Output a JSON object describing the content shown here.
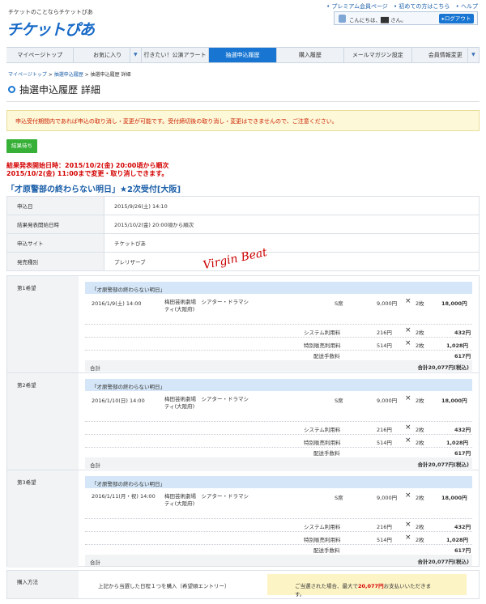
{
  "header": {
    "tagline": "チケットのことならチケットぴあ",
    "logo": "チケットぴあ",
    "links": [
      "• プレミアム会員ページ",
      "• 初めての方はこちら",
      "• ヘルプ"
    ],
    "greeting": "こんにちは、██ さん。",
    "logout": "▸ログアウト"
  },
  "nav": {
    "items": [
      "マイページトップ",
      "お気に入り",
      "行きたい！公演アラート",
      "抽選申込履歴",
      "購入履歴",
      "メールマガジン設定",
      "会員情報変更"
    ],
    "active_index": 3
  },
  "breadcrumb": [
    "マイページトップ",
    "抽選申込履歴",
    "抽選申込履歴 詳細"
  ],
  "page_title": "抽選申込履歴 詳細",
  "notice": "申込受付期間内であれば申込の取り消し・変更が可能です。受付締切後の取り消し・変更はできませんので、ご注意ください。",
  "status_button": "結果待ち",
  "result_announcement": [
    "結果発表開始日時：2015/10/2(金) 20:00頃から順次",
    "2015/10/2(金) 11:00まで変更・取り消しできます。"
  ],
  "event_title": "「才原警部の終わらない明日」★2次受付[大阪]",
  "info": [
    {
      "label": "申込日",
      "value": "2015/9/26(土) 14:10"
    },
    {
      "label": "結果発表開始日時",
      "value": "2015/10/2(金) 20:00頃から順次"
    },
    {
      "label": "申込サイト",
      "value": "チケットぴあ"
    },
    {
      "label": "発売種別",
      "value": "プレリザーブ"
    }
  ],
  "signature": "Virgin Beat",
  "choices": [
    {
      "label": "第1希望",
      "title": "「才原警部の終わらない明日」",
      "date": "2016/1/9(土) 14:00",
      "venue": "梅田芸術劇場　シアター・ドラマシティ(大阪府)",
      "seat": "S席",
      "unit_price": "9,000円",
      "times": "×",
      "qty": "2枚",
      "amount": "18,000円",
      "system_label": "システム利用料",
      "system_unit": "216円",
      "system_qty": "2枚",
      "system_amount": "432円",
      "special_label": "特別販売利用料",
      "special_unit": "514円",
      "special_qty": "2枚",
      "special_amount": "1,028円",
      "delivery_label": "配送手数料",
      "delivery_amount": "617円",
      "total_label": "合計",
      "total_value": "合計20,077円(税込)"
    },
    {
      "label": "第2希望",
      "title": "「才原警部の終わらない明日」",
      "date": "2016/1/10(日) 14:00",
      "venue": "梅田芸術劇場　シアター・ドラマシティ(大阪府)",
      "seat": "S席",
      "unit_price": "9,000円",
      "times": "×",
      "qty": "2枚",
      "amount": "18,000円",
      "system_label": "システム利用料",
      "system_unit": "216円",
      "system_qty": "2枚",
      "system_amount": "432円",
      "special_label": "特別販売利用料",
      "special_unit": "514円",
      "special_qty": "2枚",
      "special_amount": "1,028円",
      "delivery_label": "配送手数料",
      "delivery_amount": "617円",
      "total_label": "合計",
      "total_value": "合計20,077円(税込)"
    },
    {
      "label": "第3希望",
      "title": "「才原警部の終わらない明日」",
      "date": "2016/1/11(月・祝) 14:00",
      "venue": "梅田芸術劇場　シアター・ドラマシティ(大阪府)",
      "seat": "S席",
      "unit_price": "9,000円",
      "times": "×",
      "qty": "2枚",
      "amount": "18,000円",
      "system_label": "システム利用料",
      "system_unit": "216円",
      "system_qty": "2枚",
      "system_amount": "432円",
      "special_label": "特別販売利用料",
      "special_unit": "514円",
      "special_qty": "2枚",
      "special_amount": "1,028円",
      "delivery_label": "配送手数料",
      "delivery_amount": "617円",
      "total_label": "合計",
      "total_value": "合計20,077円(税込)"
    }
  ],
  "purchase": {
    "label": "購入方法",
    "method": "上記から当選した日程１つを購入（希望順エントリー）",
    "note_prefix": "ご当選された場合、最大で",
    "note_amount": "20,077円",
    "note_suffix": "お支払いいただきます。"
  }
}
